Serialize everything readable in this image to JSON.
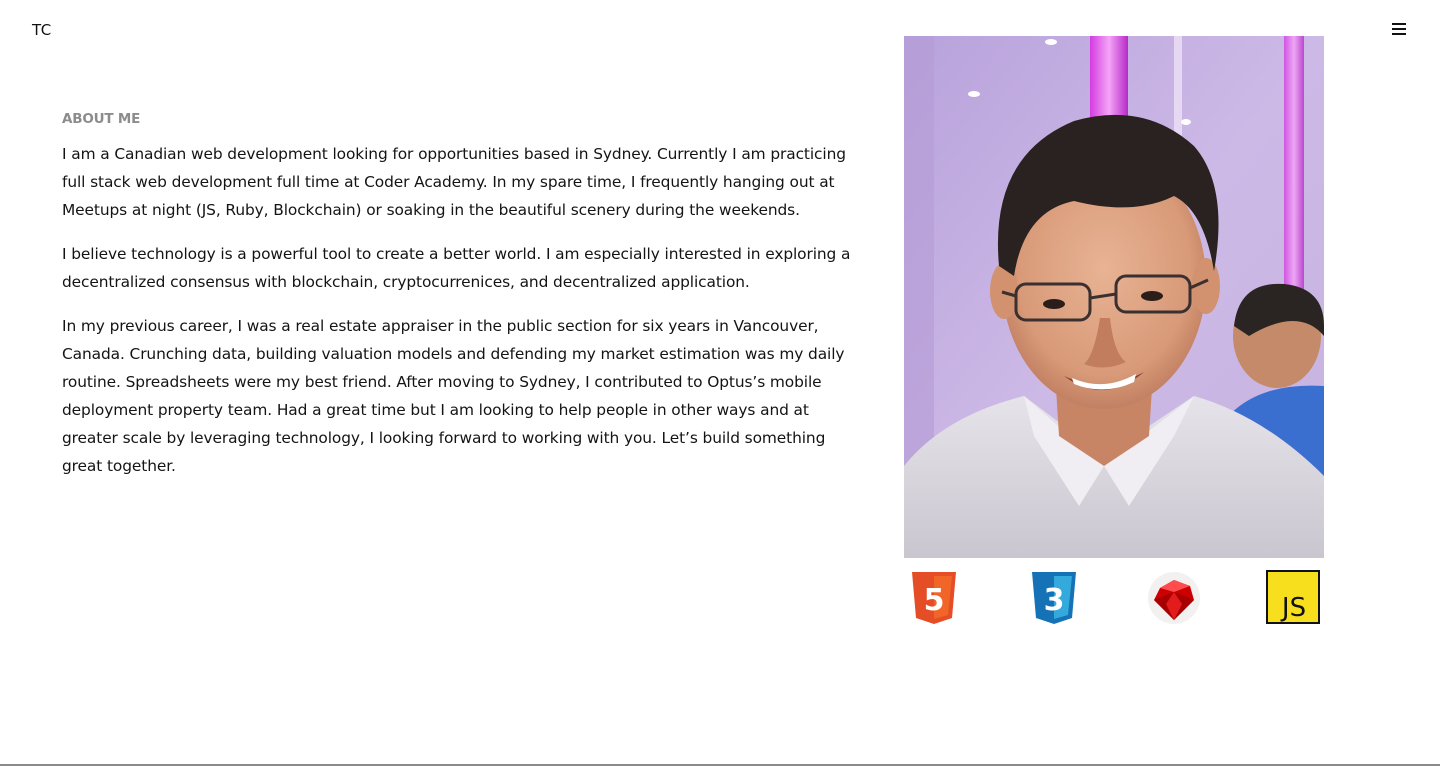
{
  "header": {
    "logo": "TC",
    "menu_icon": "hamburger-icon"
  },
  "about": {
    "heading": "ABOUT ME",
    "paragraphs": [
      "I am a Canadian web development looking for opportunities based in Sydney. Currently I am practicing full stack web development full time at Coder Academy. In my spare time, I frequently hanging out at Meetups at night (JS, Ruby, Blockchain) or soaking in the beautiful scenery during the weekends.",
      "I believe technology is a powerful tool to create a better world. I am especially interested in exploring a decentralized consensus with blockchain, cryptocurrenices, and decentralized application.",
      "In my previous career, I was a real estate appraiser in the public section for six years in Vancouver, Canada. Crunching data, building valuation models and defending my market estimation was my daily routine. Spreadsheets were my best friend. After moving to Sydney, I contributed to Optus’s mobile deployment property team. Had a great time but I am looking to help people in other ways and at greater scale by leveraging technology, I looking forward to working with you. Let’s build something great together."
    ]
  },
  "skills": [
    {
      "icon": "html5-icon",
      "label": "5",
      "color": "#e44d26"
    },
    {
      "icon": "css3-icon",
      "label": "3",
      "color": "#1572b6"
    },
    {
      "icon": "ruby-icon",
      "color": "#cc0000"
    },
    {
      "icon": "javascript-icon",
      "label": "JS",
      "color": "#f7df1e"
    }
  ]
}
